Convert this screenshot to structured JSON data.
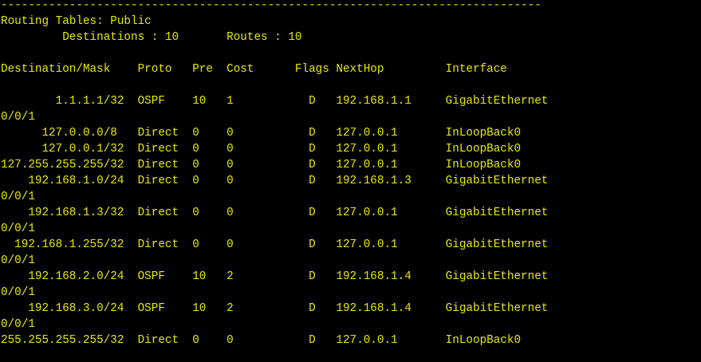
{
  "terminal": {
    "text_color": "#e8e800",
    "background": "#000000",
    "lines": [
      "-------------------------------------------------------------------------------",
      "Routing Tables: Public",
      "         Destinations : 10       Routes : 10",
      "",
      "Destination/Mask    Proto   Pre  Cost      Flags NextHop         Interface",
      "",
      "        1.1.1.1/32  OSPF    10   1           D   192.168.1.1     GigabitEthernet",
      "0/0/1",
      "      127.0.0.0/8   Direct  0    0           D   127.0.0.1       InLoopBack0",
      "      127.0.0.1/32  Direct  0    0           D   127.0.0.1       InLoopBack0",
      "127.255.255.255/32  Direct  0    0           D   127.0.0.1       InLoopBack0",
      "    192.168.1.0/24  Direct  0    0           D   192.168.1.3     GigabitEthernet",
      "0/0/1",
      "    192.168.1.3/32  Direct  0    0           D   127.0.0.1       GigabitEthernet",
      "0/0/1",
      "  192.168.1.255/32  Direct  0    0           D   127.0.0.1       GigabitEthernet",
      "0/0/1",
      "    192.168.2.0/24  OSPF    10   2           D   192.168.1.4     GigabitEthernet",
      "0/0/1",
      "    192.168.3.0/24  OSPF    10   2           D   192.168.1.4     GigabitEthernet",
      "0/0/1",
      "255.255.255.255/32  Direct  0    0           D   127.0.0.1       InLoopBack0"
    ]
  }
}
